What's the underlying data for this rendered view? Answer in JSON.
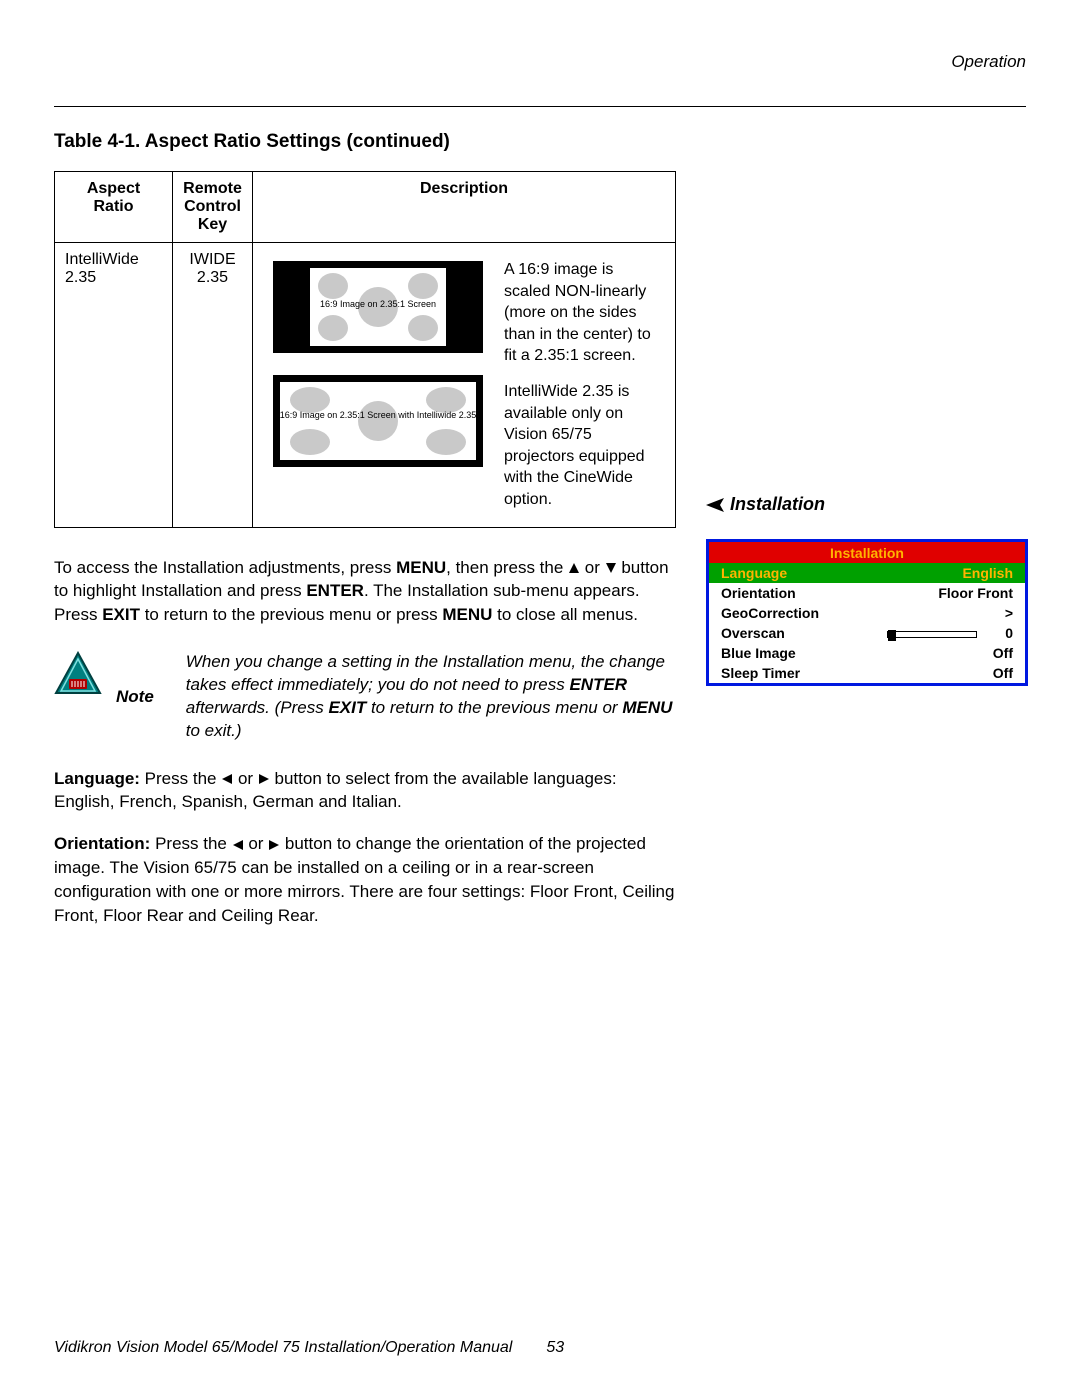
{
  "header": {
    "section": "Operation"
  },
  "table": {
    "title": "Table 4-1. Aspect Ratio Settings (continued)",
    "headers": [
      "Aspect Ratio",
      "Remote Control Key",
      "Description"
    ],
    "row": {
      "aspect": "IntelliWide 2.35",
      "key": "IWIDE 2.35",
      "caption1": "16:9 Image on 2.35:1 Screen",
      "caption2": "16:9 Image on 2.35:1 Screen with Intelliwide 2.35",
      "desc1": "A 16:9 image is scaled NON-linearly (more on the sides than in the center) to fit a 2.35:1 screen.",
      "desc2": "IntelliWide 2.35 is available only on Vision 65/75 projectors equipped with the CineWide option."
    }
  },
  "body": {
    "access": {
      "pre": "To access the Installation adjustments, press ",
      "menu": "MENU",
      "mid1": ", then press the ",
      "or": " or ",
      "mid2": " button to highlight Installation and press ",
      "enter": "ENTER",
      "post1": ". The Installation sub-menu appears. Press ",
      "exit": "EXIT",
      "post2": " to return to the previous menu or press ",
      "post3": " to close all menus."
    },
    "note_label": "Note",
    "note": {
      "pre": "When you change a setting in the Installation menu, the change takes effect immediately; you do not need to press ",
      "enter": "ENTER",
      "mid": " afterwards. (Press ",
      "exit": "EXIT",
      "mid2": " to return to the previous menu or ",
      "menu": "MENU",
      "post": " to exit.)"
    },
    "language": {
      "label": "Language:",
      "pre": " Press the ",
      "or": " or ",
      "post": " button to select from the available languages: English, French, Spanish, German and Italian."
    },
    "orientation": {
      "label": "Orientation:",
      "pre": " Press the ",
      "or": " or ",
      "post": " button to change the orientation of the projected image. The Vision 65/75 can be installed on a ceiling or in a rear-screen configuration with one or more mirrors. There are four settings: Floor Front, Ceiling Front, Floor Rear and Ceiling Rear."
    }
  },
  "right": {
    "label": "Installation",
    "osd": {
      "title": "Installation",
      "items": [
        {
          "label": "Language",
          "value": "English",
          "selected": true
        },
        {
          "label": "Orientation",
          "value": "Floor Front"
        },
        {
          "label": "GeoCorrection",
          "value": ">"
        },
        {
          "label": "Overscan",
          "value": "0",
          "slider": true
        },
        {
          "label": "Blue Image",
          "value": "Off"
        },
        {
          "label": "Sleep Timer",
          "value": "Off"
        }
      ]
    }
  },
  "footer": {
    "text": "Vidikron Vision Model 65/Model 75 Installation/Operation Manual",
    "page": "53"
  }
}
